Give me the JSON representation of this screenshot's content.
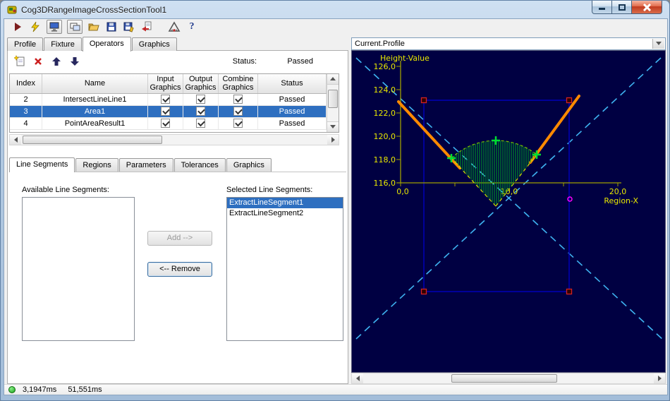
{
  "window": {
    "title": "Cog3DRangeImageCrossSectionTool1"
  },
  "toolbar": {
    "help_glyph": "?"
  },
  "tabs": {
    "items": [
      {
        "label": "Profile",
        "active": false
      },
      {
        "label": "Fixture",
        "active": false
      },
      {
        "label": "Operators",
        "active": true
      },
      {
        "label": "Graphics",
        "active": false
      }
    ]
  },
  "operators": {
    "status_label": "Status:",
    "status_value": "Passed",
    "grid": {
      "columns": {
        "index": "Index",
        "name": "Name",
        "input": "Input Graphics",
        "output": "Output Graphics",
        "combine": "Combine Graphics",
        "status": "Status"
      },
      "rows": [
        {
          "index": "2",
          "name": "IntersectLineLine1",
          "input_graphics": true,
          "output_graphics": true,
          "combine_graphics": true,
          "status": "Passed",
          "selected": false
        },
        {
          "index": "3",
          "name": "Area1",
          "input_graphics": true,
          "output_graphics": true,
          "combine_graphics": true,
          "status": "Passed",
          "selected": true
        },
        {
          "index": "4",
          "name": "PointAreaResult1",
          "input_graphics": true,
          "output_graphics": true,
          "combine_graphics": true,
          "status": "Passed",
          "selected": false
        }
      ]
    },
    "subtabs": {
      "items": [
        {
          "label": "Line Segments",
          "active": true
        },
        {
          "label": "Regions",
          "active": false
        },
        {
          "label": "Parameters",
          "active": false
        },
        {
          "label": "Tolerances",
          "active": false
        },
        {
          "label": "Graphics",
          "active": false
        }
      ]
    },
    "line_segments": {
      "available_label": "Available Line Segments:",
      "selected_label": "Selected Line Segments:",
      "add_label": "Add --&gt;",
      "add_label_plain": "Add -->",
      "remove_label": "<-- Remove",
      "available_items": [],
      "selected_items": [
        {
          "label": "ExtractLineSegment1",
          "selected": true
        },
        {
          "label": "ExtractLineSegment2",
          "selected": false
        }
      ]
    }
  },
  "display": {
    "record_selector": "Current.Profile",
    "plot": {
      "y_axis_title": "Height-Value",
      "x_axis_title": "Region-X",
      "y_ticks": [
        "126,0",
        "124,0",
        "122,0",
        "120,0",
        "118,0",
        "116,0"
      ],
      "x_ticks": [
        "0,0",
        "10,0",
        "20,0"
      ],
      "colors": {
        "background": "#000042",
        "axis": "#a0a000",
        "labels": "#e8e800",
        "crosshair": "#3fb4f2",
        "region_rect": "#0000b8",
        "profile_lines": "#ff8a00",
        "area_hatch": "#00aa22",
        "markers": "#00dd33",
        "result_point": "#ff00ff"
      }
    }
  },
  "statusbar": {
    "process_time": "3,1947ms",
    "total_time": "51,551ms"
  }
}
